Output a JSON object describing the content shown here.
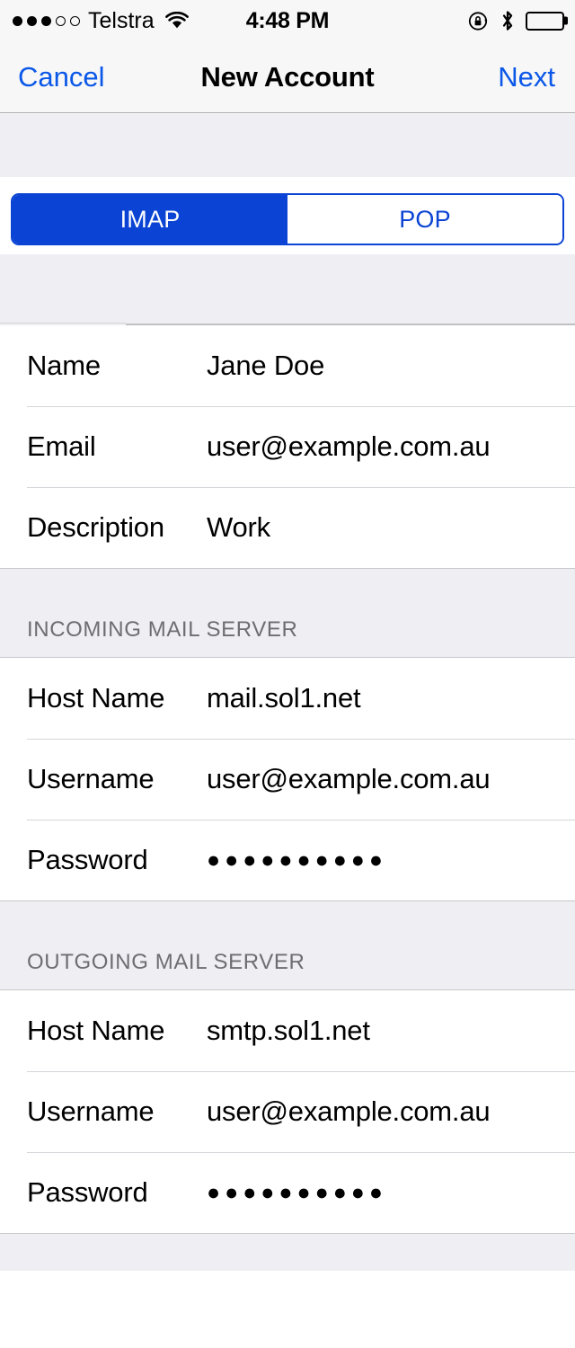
{
  "status_bar": {
    "signal_dots_filled": 3,
    "signal_dots_empty": 2,
    "carrier": "Telstra",
    "wifi_icon": "wifi-icon",
    "time": "4:48 PM",
    "rotation_lock_icon": "rotation-lock-icon",
    "bluetooth_icon": "bluetooth-icon",
    "battery_icon": "battery-full-icon"
  },
  "nav_bar": {
    "cancel_label": "Cancel",
    "title": "New Account",
    "next_label": "Next",
    "tint_color": "#0a57e8"
  },
  "segmented_control": {
    "accent_color": "#0b44d4",
    "selected": "IMAP",
    "options": [
      {
        "label": "IMAP",
        "selected": true
      },
      {
        "label": "POP",
        "selected": false
      }
    ]
  },
  "sections": [
    {
      "header": "",
      "rows": [
        {
          "label": "Name",
          "value": "Jane Doe",
          "secure": false
        },
        {
          "label": "Email",
          "value": "user@example.com.au",
          "secure": false
        },
        {
          "label": "Description",
          "value": "Work",
          "secure": false
        }
      ]
    },
    {
      "header": "INCOMING MAIL SERVER",
      "rows": [
        {
          "label": "Host Name",
          "value": "mail.sol1.net",
          "secure": false
        },
        {
          "label": "Username",
          "value": "user@example.com.au",
          "secure": false
        },
        {
          "label": "Password",
          "value": "●●●●●●●●●●",
          "secure": true
        }
      ]
    },
    {
      "header": "OUTGOING MAIL SERVER",
      "rows": [
        {
          "label": "Host Name",
          "value": "smtp.sol1.net",
          "secure": false
        },
        {
          "label": "Username",
          "value": "user@example.com.au",
          "secure": false
        },
        {
          "label": "Password",
          "value": "●●●●●●●●●●",
          "secure": true
        }
      ]
    }
  ],
  "colors": {
    "group_background": "#eeeef3",
    "cell_background": "#ffffff",
    "bar_background": "#f7f7f7",
    "separator": "#d6d6db",
    "header_text": "#6d6d72"
  }
}
